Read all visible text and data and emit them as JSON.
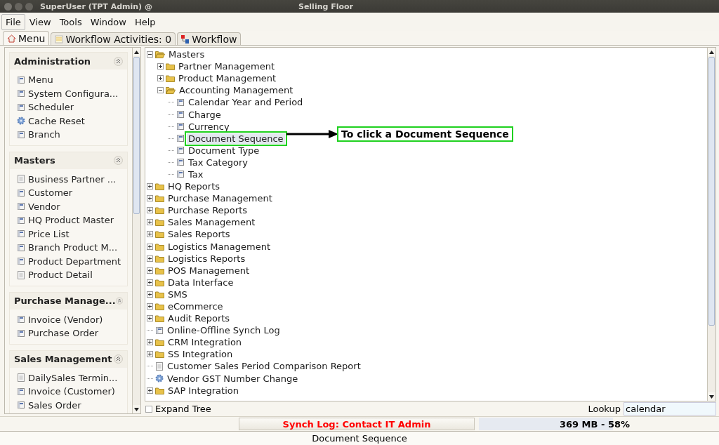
{
  "window": {
    "title": "SuperUser (TPT Admin) @",
    "subtitle": "Selling Floor"
  },
  "menu": [
    {
      "label": "File",
      "selected": true
    },
    {
      "label": "View",
      "selected": false
    },
    {
      "label": "Tools",
      "selected": false
    },
    {
      "label": "Window",
      "selected": false
    },
    {
      "label": "Help",
      "selected": false
    }
  ],
  "tabs": [
    {
      "label": "Menu",
      "kind": "home",
      "selected": true
    },
    {
      "label": "Workflow Activities: 0",
      "kind": "list",
      "selected": false
    },
    {
      "label": "Workflow",
      "kind": "flow",
      "selected": false
    }
  ],
  "sidebar": {
    "sections": [
      {
        "title": "Administration",
        "items": [
          {
            "label": "Menu",
            "kind": "window"
          },
          {
            "label": "System Configura...",
            "kind": "window"
          },
          {
            "label": "Scheduler",
            "kind": "window"
          },
          {
            "label": "Cache Reset",
            "kind": "process"
          },
          {
            "label": "Branch",
            "kind": "window"
          }
        ]
      },
      {
        "title": "Masters",
        "items": [
          {
            "label": "Business Partner ...",
            "kind": "report"
          },
          {
            "label": "Customer",
            "kind": "window"
          },
          {
            "label": "Vendor",
            "kind": "window"
          },
          {
            "label": "HQ Product Master",
            "kind": "window"
          },
          {
            "label": "Price List",
            "kind": "window"
          },
          {
            "label": "Branch Product M...",
            "kind": "window"
          },
          {
            "label": "Product Department",
            "kind": "window"
          },
          {
            "label": "Product Detail",
            "kind": "report"
          }
        ]
      },
      {
        "title": "Purchase Manage...",
        "items": [
          {
            "label": "Invoice (Vendor)",
            "kind": "window"
          },
          {
            "label": "Purchase Order",
            "kind": "window"
          }
        ]
      },
      {
        "title": "Sales Management",
        "items": [
          {
            "label": "DailySales Termin...",
            "kind": "report"
          },
          {
            "label": "Invoice (Customer)",
            "kind": "window"
          },
          {
            "label": "Sales Order",
            "kind": "window"
          }
        ]
      }
    ]
  },
  "tree": {
    "items": [
      {
        "label": "Masters",
        "kind": "folder",
        "expanded": true,
        "selected": false,
        "children": [
          {
            "label": "Partner Management",
            "kind": "folder",
            "expanded": false,
            "selected": false
          },
          {
            "label": "Product Management",
            "kind": "folder",
            "expanded": false,
            "selected": false
          },
          {
            "label": "Accounting Management",
            "kind": "folder",
            "expanded": true,
            "selected": false,
            "children": [
              {
                "label": "Calendar Year and Period",
                "kind": "window",
                "selected": false
              },
              {
                "label": "Charge",
                "kind": "window",
                "selected": false
              },
              {
                "label": "Currency",
                "kind": "window",
                "selected": false
              },
              {
                "label": "Document Sequence",
                "kind": "window",
                "selected": true
              },
              {
                "label": "Document Type",
                "kind": "window",
                "selected": false
              },
              {
                "label": "Tax Category",
                "kind": "window",
                "selected": false
              },
              {
                "label": "Tax",
                "kind": "window",
                "selected": false
              }
            ]
          }
        ]
      },
      {
        "label": "HQ Reports",
        "kind": "folder",
        "expanded": false,
        "selected": false
      },
      {
        "label": "Purchase Management",
        "kind": "folder",
        "expanded": false,
        "selected": false
      },
      {
        "label": "Purchase Reports",
        "kind": "folder",
        "expanded": false,
        "selected": false
      },
      {
        "label": "Sales Management",
        "kind": "folder",
        "expanded": false,
        "selected": false
      },
      {
        "label": "Sales Reports",
        "kind": "folder",
        "expanded": false,
        "selected": false
      },
      {
        "label": "Logistics Management",
        "kind": "folder",
        "expanded": false,
        "selected": false
      },
      {
        "label": "Logistics Reports",
        "kind": "folder",
        "expanded": false,
        "selected": false
      },
      {
        "label": "POS Management",
        "kind": "folder",
        "expanded": false,
        "selected": false
      },
      {
        "label": "Data Interface",
        "kind": "folder",
        "expanded": false,
        "selected": false
      },
      {
        "label": "SMS",
        "kind": "folder",
        "expanded": false,
        "selected": false
      },
      {
        "label": "eCommerce",
        "kind": "folder",
        "expanded": false,
        "selected": false
      },
      {
        "label": "Audit Reports",
        "kind": "folder",
        "expanded": false,
        "selected": false
      },
      {
        "label": "Online-Offline Synch Log",
        "kind": "window",
        "selected": false
      },
      {
        "label": "CRM Integration",
        "kind": "folder",
        "expanded": false,
        "selected": false
      },
      {
        "label": "SS Integration",
        "kind": "folder",
        "expanded": false,
        "selected": false
      },
      {
        "label": "Customer Sales Period Comparison Report",
        "kind": "report",
        "selected": false
      },
      {
        "label": "Vendor GST Number Change",
        "kind": "process",
        "selected": false
      },
      {
        "label": "SAP Integration",
        "kind": "folder",
        "expanded": false,
        "selected": false
      }
    ]
  },
  "annotation": {
    "text": "To click a Document Sequence"
  },
  "expand_tree": {
    "label": "Expand Tree",
    "checked": false
  },
  "lookup": {
    "label": "Lookup",
    "value": "calendar"
  },
  "synch_button": "Synch Log: Contact IT Admin",
  "memory": {
    "reading": "369 MB - 58%",
    "level": 0.58
  },
  "status_bar": "Document Sequence"
}
